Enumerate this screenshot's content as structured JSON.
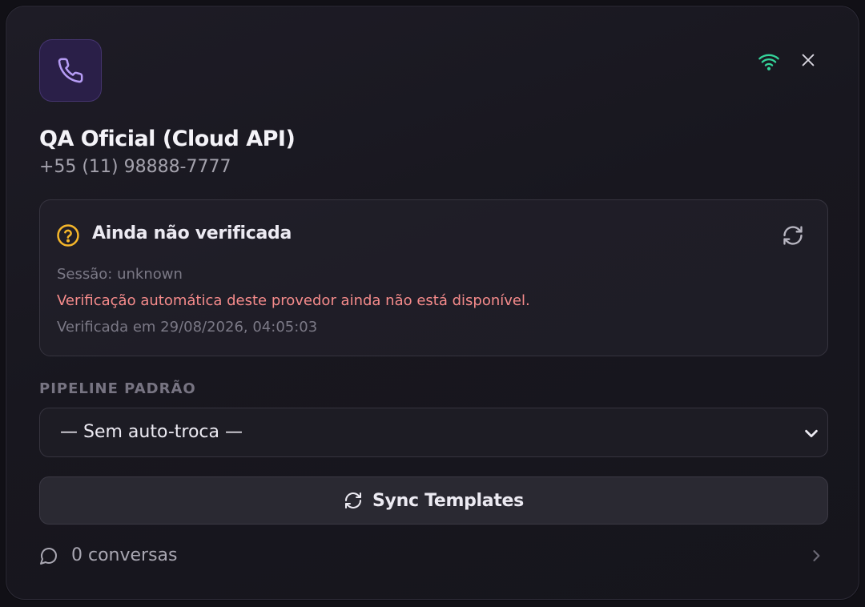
{
  "header": {
    "title": "QA Oficial (Cloud API)",
    "phone": "+55 (11) 98888-7777",
    "icons": {
      "app": "phone-icon",
      "connection": "wifi-icon",
      "close": "close-icon"
    },
    "colors": {
      "app_icon_bg": "#2a1f48",
      "app_icon_fg": "#b69cf5",
      "connection": "#34d399"
    }
  },
  "status": {
    "title": "Ainda não verificada",
    "session": "Sessão: unknown",
    "error": "Verificação automática deste provedor ainda não está disponível.",
    "verified_at": "Verificada em 29/08/2026, 04:05:03",
    "icons": {
      "status": "question-circle-icon",
      "refresh": "refresh-icon"
    },
    "colors": {
      "status_icon": "#f5b62a",
      "error_text": "#f58b8b"
    }
  },
  "pipeline": {
    "label": "PIPELINE PADRÃO",
    "selected": "— Sem auto-troca —"
  },
  "sync": {
    "label": "Sync Templates",
    "icon": "refresh-icon"
  },
  "conversations": {
    "label": "0 conversas",
    "icon": "chat-bubble-icon"
  }
}
